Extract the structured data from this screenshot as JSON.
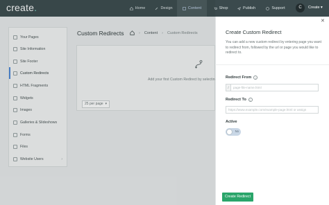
{
  "app": {
    "logo_text": "create",
    "logo_dot": "."
  },
  "topnav": {
    "items": [
      {
        "label": "Home",
        "icon": "home-icon"
      },
      {
        "label": "Design",
        "icon": "brush-icon"
      },
      {
        "label": "Content",
        "icon": "edit-icon"
      },
      {
        "label": "Shop",
        "icon": "cart-icon"
      },
      {
        "label": "Publish",
        "icon": "send-icon"
      },
      {
        "label": "Support",
        "icon": "help-icon"
      }
    ],
    "active": "Content",
    "avatar_letter": "C",
    "account_label": "Create"
  },
  "sidebar": {
    "items": [
      {
        "label": "Your Pages",
        "icon": "pages-icon"
      },
      {
        "label": "Site Information",
        "icon": "info-icon"
      },
      {
        "label": "Site Footer",
        "icon": "footer-icon"
      },
      {
        "label": "Custom Redirects",
        "icon": "redirect-icon"
      },
      {
        "label": "HTML Fragments",
        "icon": "code-icon"
      },
      {
        "label": "Widgets",
        "icon": "widgets-icon"
      },
      {
        "label": "Images",
        "icon": "image-icon"
      },
      {
        "label": "Galleries & Slideshows",
        "icon": "gallery-icon"
      },
      {
        "label": "Forms",
        "icon": "form-icon"
      },
      {
        "label": "Files",
        "icon": "file-icon"
      },
      {
        "label": "Website Users",
        "icon": "users-icon"
      }
    ],
    "active": "Custom Redirects"
  },
  "main": {
    "title": "Custom Redirects",
    "breadcrumb": {
      "home_icon": "home-icon",
      "section": "Content",
      "current": "Custom Redirects"
    },
    "empty_text": "Add your first Custom Redirect by selecting t",
    "per_page": "25 per page"
  },
  "drawer": {
    "title": "Create Custom Redirect",
    "description": "You can add a new custom redirect by entering page you want to redirect from, followed by the url or page you would like to redirect to.",
    "redirect_from_label": "Redirect From",
    "redirect_from_prefix": "/",
    "redirect_from_placeholder": "page-file-name.html",
    "redirect_to_label": "Redirect To",
    "redirect_to_placeholder": "https://www.example.com/example-page.html or assign",
    "active_label": "Active",
    "active_state": "No",
    "submit_label": "Create Redirect",
    "close_icon": "close-icon"
  },
  "colors": {
    "topbar": "#3b4a4d",
    "accent": "#4b86d8",
    "primary_button": "#2aa56a"
  }
}
